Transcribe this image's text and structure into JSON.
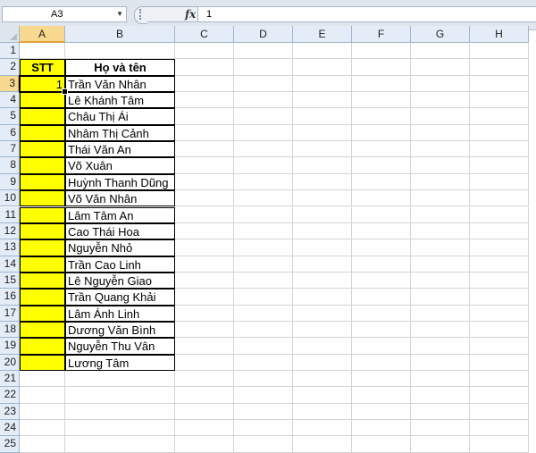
{
  "formula_bar": {
    "name_box": "A3",
    "fx_label": "fx",
    "value": "1"
  },
  "columns": [
    "A",
    "B",
    "C",
    "D",
    "E",
    "F",
    "G",
    "H"
  ],
  "rows": [
    "1",
    "2",
    "3",
    "4",
    "5",
    "6",
    "7",
    "8",
    "9",
    "10",
    "11",
    "12",
    "13",
    "14",
    "15",
    "16",
    "17",
    "18",
    "19",
    "20",
    "21",
    "22",
    "23",
    "24",
    "25"
  ],
  "table": {
    "header_stt": "STT",
    "header_name": "Họ và tên",
    "stt_values": [
      "1",
      "",
      "",
      "",
      "",
      "",
      "",
      "",
      "",
      "",
      "",
      "",
      "",
      "",
      "",
      "",
      "",
      ""
    ],
    "names": [
      "Trần Văn Nhân",
      "Lê Khánh Tâm",
      "Châu Thị Ái",
      "Nhâm Thị Cảnh",
      "Thái Văn An",
      "Võ Xuân",
      "Huỳnh Thanh Dũng",
      "Võ Văn Nhân",
      "Lâm Tâm An",
      "Cao Thái Hoa",
      "Nguyễn Nhỏ",
      "Trần Cao Linh",
      "Lê Nguyễn Giao",
      "Trần Quang Khải",
      "Lâm Ánh Linh",
      "Dương Văn Bình",
      "Nguyễn Thu Vân",
      "Lương Tâm"
    ]
  },
  "colors": {
    "highlight": "#ffff00",
    "selected_header": "#f9d98f",
    "header_bg": "#e4ecf7"
  }
}
